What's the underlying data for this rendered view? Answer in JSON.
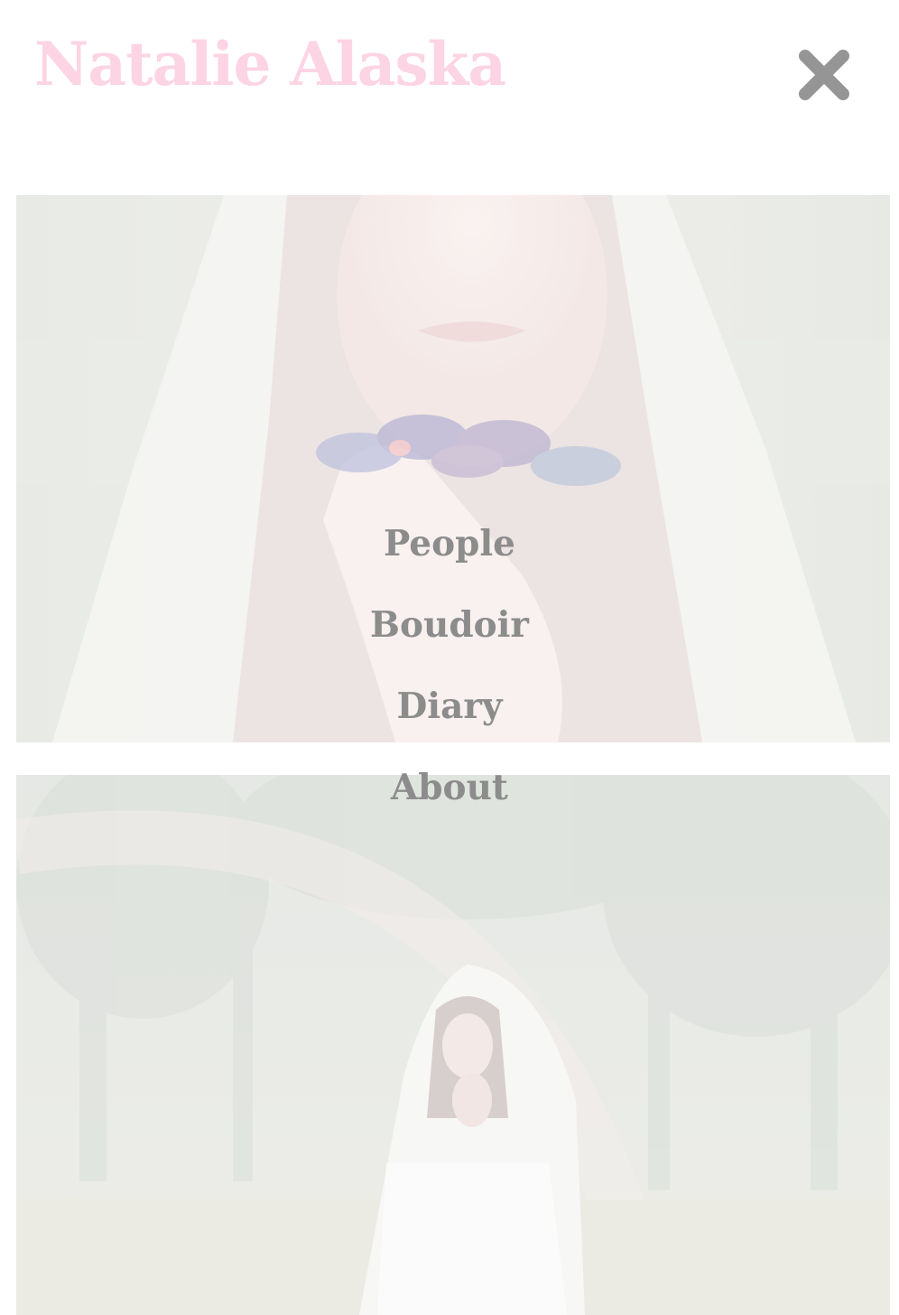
{
  "header": {
    "site_title": "Natalie Alaska",
    "close_icon": "close-icon"
  },
  "nav": {
    "items": [
      {
        "label": "People"
      },
      {
        "label": "Boudoir"
      },
      {
        "label": "Diary"
      },
      {
        "label": "About"
      }
    ]
  },
  "gallery": {
    "images": [
      {
        "name": "veiled-portrait-with-flowers"
      },
      {
        "name": "veiled-figure-in-forest"
      }
    ]
  },
  "colors": {
    "title": "#fcd4e4",
    "nav_text": "#8c8c8c",
    "close_icon": "#959595",
    "overlay": "#ffffff"
  }
}
